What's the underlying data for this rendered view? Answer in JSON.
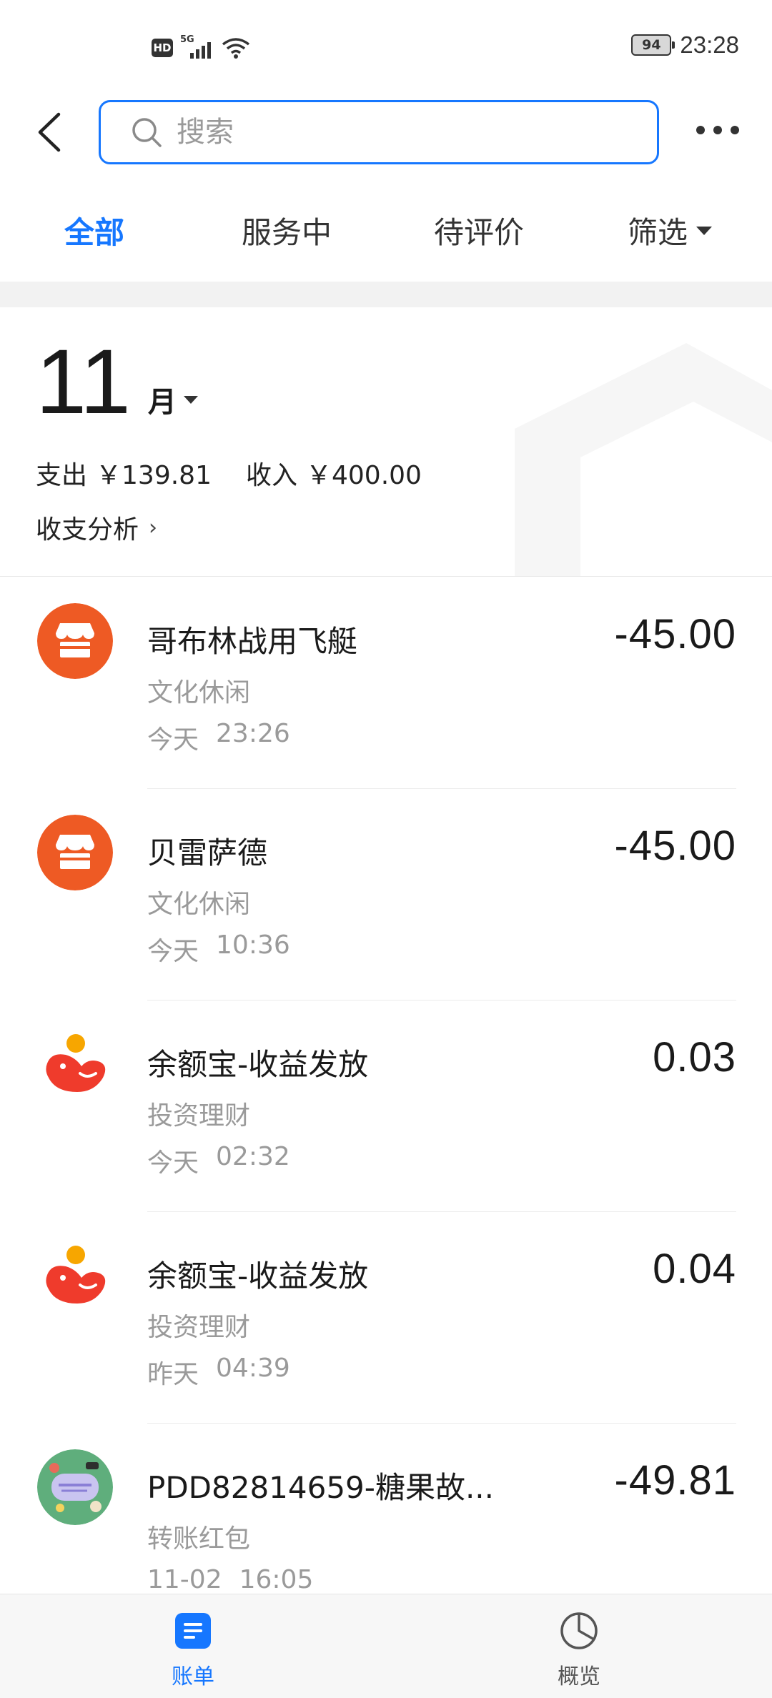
{
  "status_bar": {
    "hd": "HD",
    "network": "5G",
    "battery": "94",
    "time": "23:28"
  },
  "header": {
    "search_placeholder": "搜索"
  },
  "tabs": [
    {
      "label": "全部",
      "active": true
    },
    {
      "label": "服务中",
      "active": false
    },
    {
      "label": "待评价",
      "active": false
    },
    {
      "label": "筛选",
      "active": false
    }
  ],
  "summary": {
    "month": "11",
    "month_unit": "月",
    "expense_label": "支出",
    "expense_value": "￥139.81",
    "income_label": "收入",
    "income_value": "￥400.00",
    "analysis_label": "收支分析",
    "analysis_chevron": "›"
  },
  "transactions": [
    {
      "title": "哥布林战用飞艇",
      "category": "文化休闲",
      "day": "今天",
      "time": "23:26",
      "amount": "-45.00",
      "icon": "store-icon",
      "icon_color": "#ee5a24"
    },
    {
      "title": "贝雷萨德",
      "category": "文化休闲",
      "day": "今天",
      "time": "10:36",
      "amount": "-45.00",
      "icon": "store-icon",
      "icon_color": "#ee5a24"
    },
    {
      "title": "余额宝-收益发放",
      "category": "投资理财",
      "day": "今天",
      "time": "02:32",
      "amount": "0.03",
      "icon": "yuebao-icon",
      "icon_color": "#ef3b2c"
    },
    {
      "title": "余额宝-收益发放",
      "category": "投资理财",
      "day": "昨天",
      "time": "04:39",
      "amount": "0.04",
      "icon": "yuebao-icon",
      "icon_color": "#ef3b2c"
    },
    {
      "title": "PDD82814659-糖果故...",
      "category": "转账红包",
      "day": "11-02",
      "time": "16:05",
      "amount": "-49.81",
      "icon": "shop-avatar-icon",
      "icon_color": "#5fae7c"
    }
  ],
  "bottom_nav": [
    {
      "label": "账单",
      "icon": "bill-icon",
      "active": true,
      "color": "#1677ff"
    },
    {
      "label": "概览",
      "icon": "pie-chart-icon",
      "active": false,
      "color": "#555555"
    }
  ]
}
